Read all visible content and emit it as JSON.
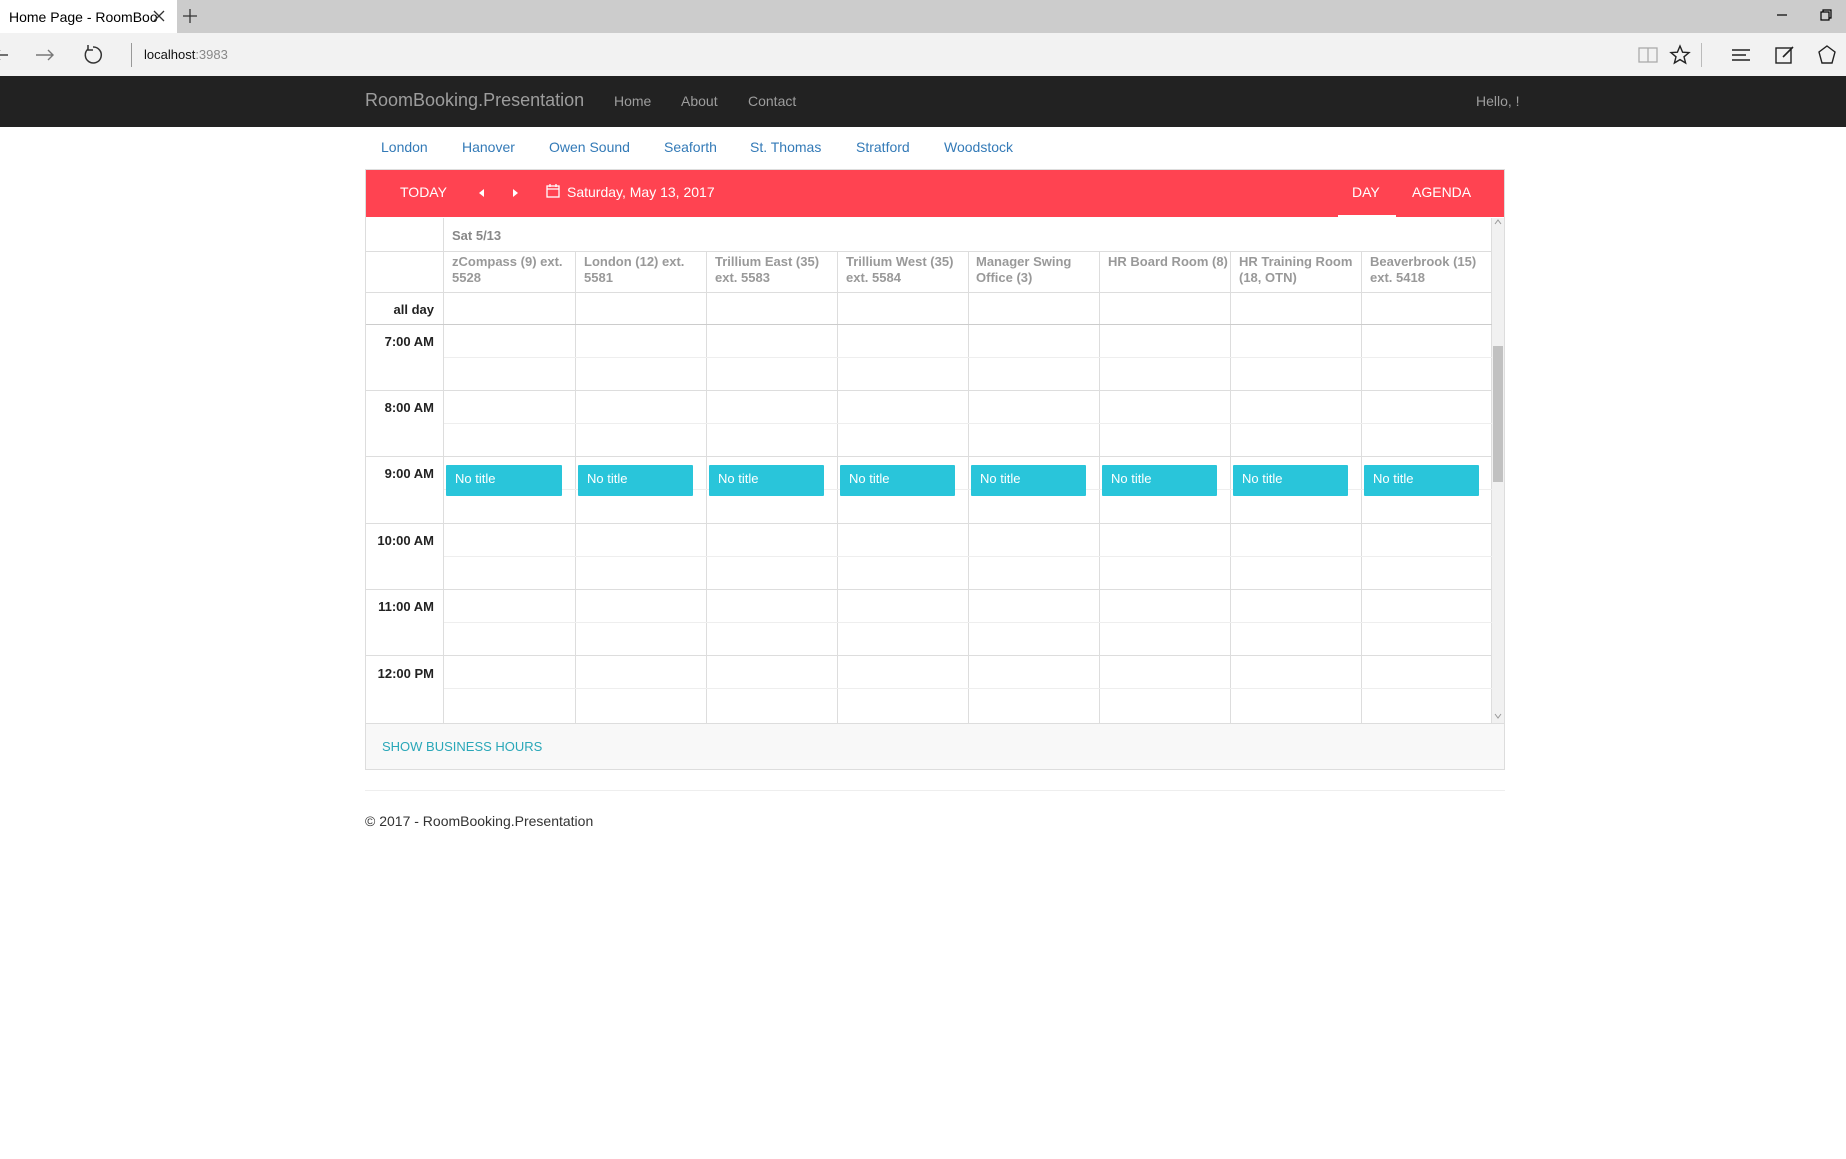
{
  "browser": {
    "tab_title": "Home Page - RoomBoo",
    "url_host": "localhost",
    "url_port": ":3983"
  },
  "navbar": {
    "brand": "RoomBooking.Presentation",
    "links": [
      "Home",
      "About",
      "Contact"
    ],
    "greeting": "Hello, !"
  },
  "locations": [
    "London",
    "Hanover",
    "Owen Sound",
    "Seaforth",
    "St. Thomas",
    "Stratford",
    "Woodstock"
  ],
  "scheduler": {
    "today_label": "TODAY",
    "date_label": "Saturday, May 13, 2017",
    "views": [
      "DAY",
      "AGENDA"
    ],
    "active_view": "DAY",
    "date_header": "Sat 5/13",
    "resources": [
      "zCompass (9) ext. 5528",
      "London (12) ext. 5581",
      "Trillium East (35) ext. 5583",
      "Trillium West (35) ext. 5584",
      "Manager Swing Office (3)",
      "HR Board Room (8)",
      "HR Training Room (18, OTN)",
      "Beaverbrook (15) ext. 5418"
    ],
    "all_day_label": "all day",
    "times": [
      "7:00 AM",
      "8:00 AM",
      "9:00 AM",
      "10:00 AM",
      "11:00 AM",
      "12:00 PM"
    ],
    "events": [
      {
        "title": "No title",
        "resource": 0,
        "time": "9:00 AM"
      },
      {
        "title": "No title",
        "resource": 1,
        "time": "9:00 AM"
      },
      {
        "title": "No title",
        "resource": 2,
        "time": "9:00 AM"
      },
      {
        "title": "No title",
        "resource": 3,
        "time": "9:00 AM"
      },
      {
        "title": "No title",
        "resource": 4,
        "time": "9:00 AM"
      },
      {
        "title": "No title",
        "resource": 5,
        "time": "9:00 AM"
      },
      {
        "title": "No title",
        "resource": 6,
        "time": "9:00 AM"
      },
      {
        "title": "No title",
        "resource": 7,
        "time": "9:00 AM"
      }
    ],
    "footer_link": "SHOW BUSINESS HOURS",
    "colors": {
      "toolbar": "#ff4351",
      "event": "#29c5da"
    }
  },
  "footer": {
    "text": "© 2017 - RoomBooking.Presentation"
  }
}
